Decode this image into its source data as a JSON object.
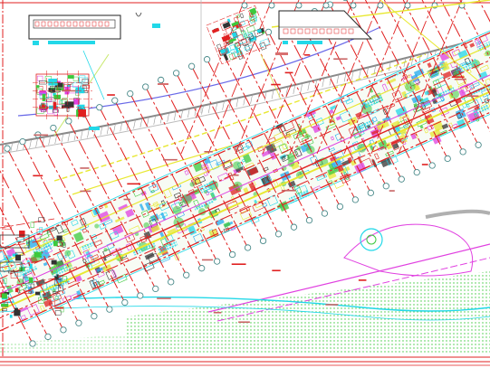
{
  "drawing": {
    "background": "#ffffff",
    "accent_grid": "#e02020",
    "cyan": "#22d8e8",
    "green": "#3cc93c",
    "yellow": "#e8e832",
    "magenta": "#e040e0",
    "blue_arc": "#6a6ae8",
    "gray_arc": "#8a8a8a",
    "dark": "#222222",
    "axis_marker_color": "#4a8a8a",
    "layers": [
      "site-boundary",
      "road-centerlines",
      "building-grid-axes",
      "axis-markers",
      "dense-building-footprints",
      "landscape-hatch",
      "detail-callout-left",
      "detail-callout-top",
      "title-block-top-left",
      "title-block-top-right"
    ]
  }
}
